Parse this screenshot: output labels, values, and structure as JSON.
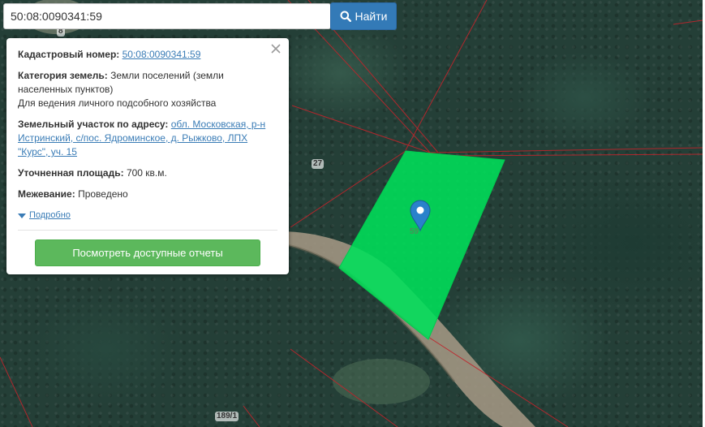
{
  "search": {
    "value": "50:08:0090341:59",
    "button_label": "Найти"
  },
  "popup": {
    "cadastral_label": "Кадастровый номер:",
    "cadastral_value": "50:08:0090341:59",
    "category_label": "Категория земель:",
    "category_value": "Земли поселений (земли населенных пунктов)",
    "usage_value": "Для ведения личного подсобного хозяйства",
    "address_label": "Земельный участок по адресу:",
    "address_value": "обл. Московская, р-н Истринский, с/пос. Ядроминское, д. Рыжково, ЛПХ \"Курс\", уч. 15",
    "area_label": "Уточненная площадь:",
    "area_value": "700 кв.м.",
    "survey_label": "Межевание:",
    "survey_value": "Проведено",
    "details_link": "Подробно",
    "reports_button": "Посмотреть доступные отчеты"
  },
  "map": {
    "labels": {
      "plot_27": "27",
      "plot_189_1": "189/1",
      "plot_top": "8",
      "marker_plot": "59"
    },
    "colors": {
      "highlight_fill": "#00e05a",
      "boundary_line": "#c0242b",
      "marker": "#2a81cb",
      "search_button": "#337ab7",
      "reports_button": "#5cb85c",
      "link": "#3a7cb6"
    }
  },
  "icons": [
    "search-icon",
    "close-icon",
    "map-marker-icon",
    "caret-down-icon"
  ]
}
